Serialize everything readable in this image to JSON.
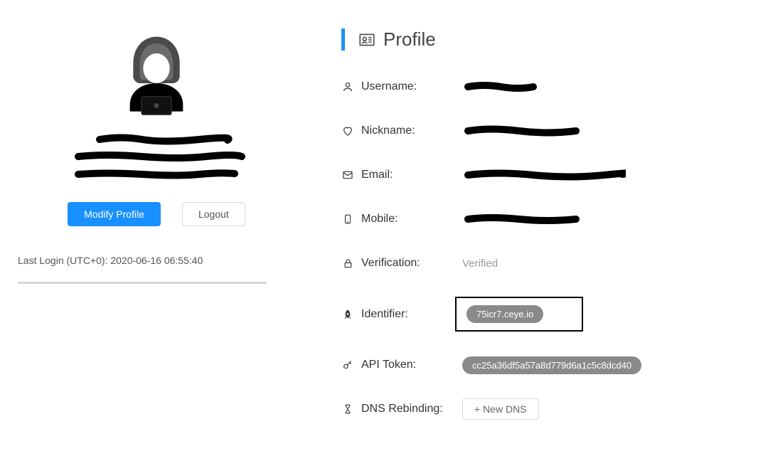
{
  "buttons": {
    "modify_profile": "Modify Profile",
    "logout": "Logout",
    "new_dns": "+ New DNS"
  },
  "last_login": "Last Login (UTC+0): 2020-06-16 06:55:40",
  "header": {
    "title": "Profile"
  },
  "fields": {
    "username": {
      "label": "Username:"
    },
    "nickname": {
      "label": "Nickname:"
    },
    "email": {
      "label": "Email:"
    },
    "mobile": {
      "label": "Mobile:"
    },
    "verification": {
      "label": "Verification:",
      "value": "Verified"
    },
    "identifier": {
      "label": "Identifier:",
      "value": "75icr7.ceye.io"
    },
    "api_token": {
      "label": "API Token:",
      "value": "cc25a36df5a57a8d779d6a1c5c8dcd40"
    },
    "dns_rebinding": {
      "label": "DNS Rebinding:"
    }
  }
}
